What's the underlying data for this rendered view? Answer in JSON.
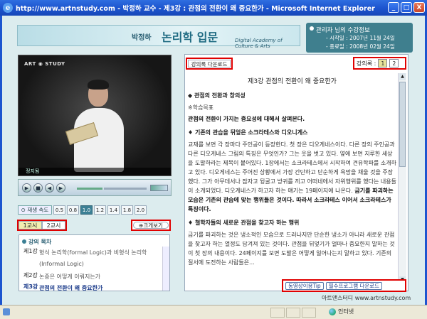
{
  "window": {
    "title": "http://www.artnstudy.com - 박정하 교수 - 제3강 : 관점의 전환이 왜 중요한가 - Microsoft Internet Explorer",
    "minimize": "_",
    "maximize": "□",
    "close": "X"
  },
  "header": {
    "author": "박정하",
    "course": "논리학 입문",
    "subtitle": "Digital Academy of Culture & Arts"
  },
  "info": {
    "title": "관리자 님의 수강정보",
    "start": "- 시작일 : 2007년 11월 24일",
    "end": "- 종료일 : 2008년 02월 24일"
  },
  "player": {
    "logo": "ART ◉ STUDY",
    "caption": "정지됨"
  },
  "speed": {
    "label": "재생 속도",
    "options": [
      "0.5",
      "0.8",
      "1.0",
      "1.2",
      "1.4",
      "1.8",
      "2.0"
    ],
    "selected": "1.0"
  },
  "sessions": {
    "items": [
      "1교시",
      "2교시"
    ],
    "selected": "1교시"
  },
  "bigview": "크게보기",
  "toc": {
    "title": "강의 목차",
    "items": [
      {
        "num": "제1강",
        "text": "형식 논리학(formal Logic)과 비형식 논리학(Informal Logic)"
      },
      {
        "num": "제2강",
        "text": "논증은 어떻게 이뤄지는가"
      },
      {
        "num": "제3강",
        "text": "관점의 전환이 왜 중요한가"
      }
    ]
  },
  "doc": {
    "download": "강의록 다운로드",
    "pages_label": "강의록 :",
    "pages": [
      "1",
      "2"
    ],
    "current_page": "1",
    "title": "제3강 관점의 전환이 왜 중요한가",
    "heading1": "◆ 관점의 전환과 창의성",
    "goal_label": "※학습목표",
    "goal_text": "관점의 전환이 가지는 중요성에 대해서 살펴본다.",
    "heading2": "♦ 기존의 관습을 뒤엎은 소크라테스와 디오니게스",
    "para1a": "교재를 보면 각 장마다 주인공이 등장한다. 첫 장은 디오게네스이다. 다른 장의 주인공과 다른 디오게네스 그림의 특징은 무엇인가? 그는 웃을 벗고 있다. 옆에 보면 지루한 세상을 도발하라는 제목이 붙어있다. 1장에서는 소크라테스에서 시작하여 견유학파를 소개하고 있다. 디오게네스는 주어진 상황에서 가장 간단하고 단순하게 욕망을 채울 것을 주장했다. 그가 아무데서나 잠자고 뒹굴고 방귀를 끼고 어떠네에서 자위행위를 했다는 내용들이 소개되었다. 디오게네스가 하고자 하는 얘기는 19페이지에 나온다.",
    "para1b": "금기를 파괴하는 모습은 기존의 관습에 맞는 행위들은 것이다. 따라서 소크라테스 이어서 소크라테스가 특징이다.",
    "heading3": "♦ 철학자들의 새로운 관점을 찾고자 하는 행위",
    "para2": "금기를 파괴하는 것은 냉소적인 모습으로 드러나지만 단순한 냉소가 아니라 새로운 관점을 찾고자 하는 열정도 담겨져 있는 것이다. 관점을 뒤엎기가 얼마나 중요한지 말하는 것이 첫 장의 내용이다. 24페이지를 보면 도발은 어떻게 일어나는지 말하고 있다. 기존의 질서에 도전하는 사람들은...",
    "tip_btn": "동영상이용Tip",
    "program_btn": "필수프로그램 다운로드"
  },
  "footer": {
    "brand": "아트앤스터디 www.artnstudy.com"
  },
  "status": {
    "zone": "인터넷"
  }
}
